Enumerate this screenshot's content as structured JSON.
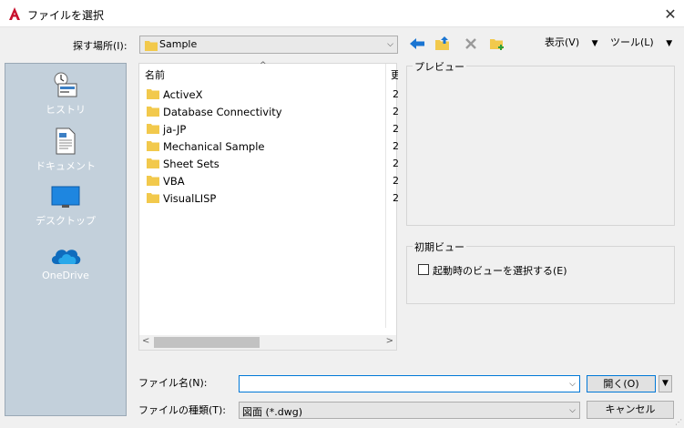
{
  "window": {
    "title": "ファイルを選択",
    "close": "✕",
    "app_icon": "autocad-icon"
  },
  "lookin": {
    "label": "探す場所(I):",
    "value": "Sample"
  },
  "toolbar": {
    "view_menu": "表示(V)",
    "tools_menu": "ツール(L)",
    "icons": [
      "back-arrow-icon",
      "up-folder-icon",
      "delete-icon",
      "new-folder-icon"
    ]
  },
  "sidebar": {
    "items": [
      {
        "label": "ヒストリ",
        "icon": "history-icon"
      },
      {
        "label": "ドキュメント",
        "icon": "documents-icon"
      },
      {
        "label": "デスクトップ",
        "icon": "desktop-icon"
      },
      {
        "label": "OneDrive",
        "icon": "onedrive-icon"
      }
    ]
  },
  "filelist": {
    "header_name": "名前",
    "header_date": "更",
    "rows": [
      {
        "name": "ActiveX",
        "date": "2"
      },
      {
        "name": "Database Connectivity",
        "date": "2"
      },
      {
        "name": "ja-JP",
        "date": "2"
      },
      {
        "name": "Mechanical Sample",
        "date": "2"
      },
      {
        "name": "Sheet Sets",
        "date": "2"
      },
      {
        "name": "VBA",
        "date": "2"
      },
      {
        "name": "VisualLISP",
        "date": "2"
      }
    ]
  },
  "preview": {
    "title": "プレビュー"
  },
  "initial_view": {
    "title": "初期ビュー",
    "checkbox_label": "起動時のビューを選択する(E)",
    "checked": false
  },
  "filename": {
    "label": "ファイル名(N):",
    "value": ""
  },
  "filetype": {
    "label": "ファイルの種類(T):",
    "value": "図面 (*.dwg)"
  },
  "buttons": {
    "open": "開く(O)",
    "cancel": "キャンセル"
  },
  "colors": {
    "accent": "#0078d7",
    "sidebar_bg": "#c3d0db",
    "folder": "#f2c94c",
    "app_red": "#c8102e"
  }
}
